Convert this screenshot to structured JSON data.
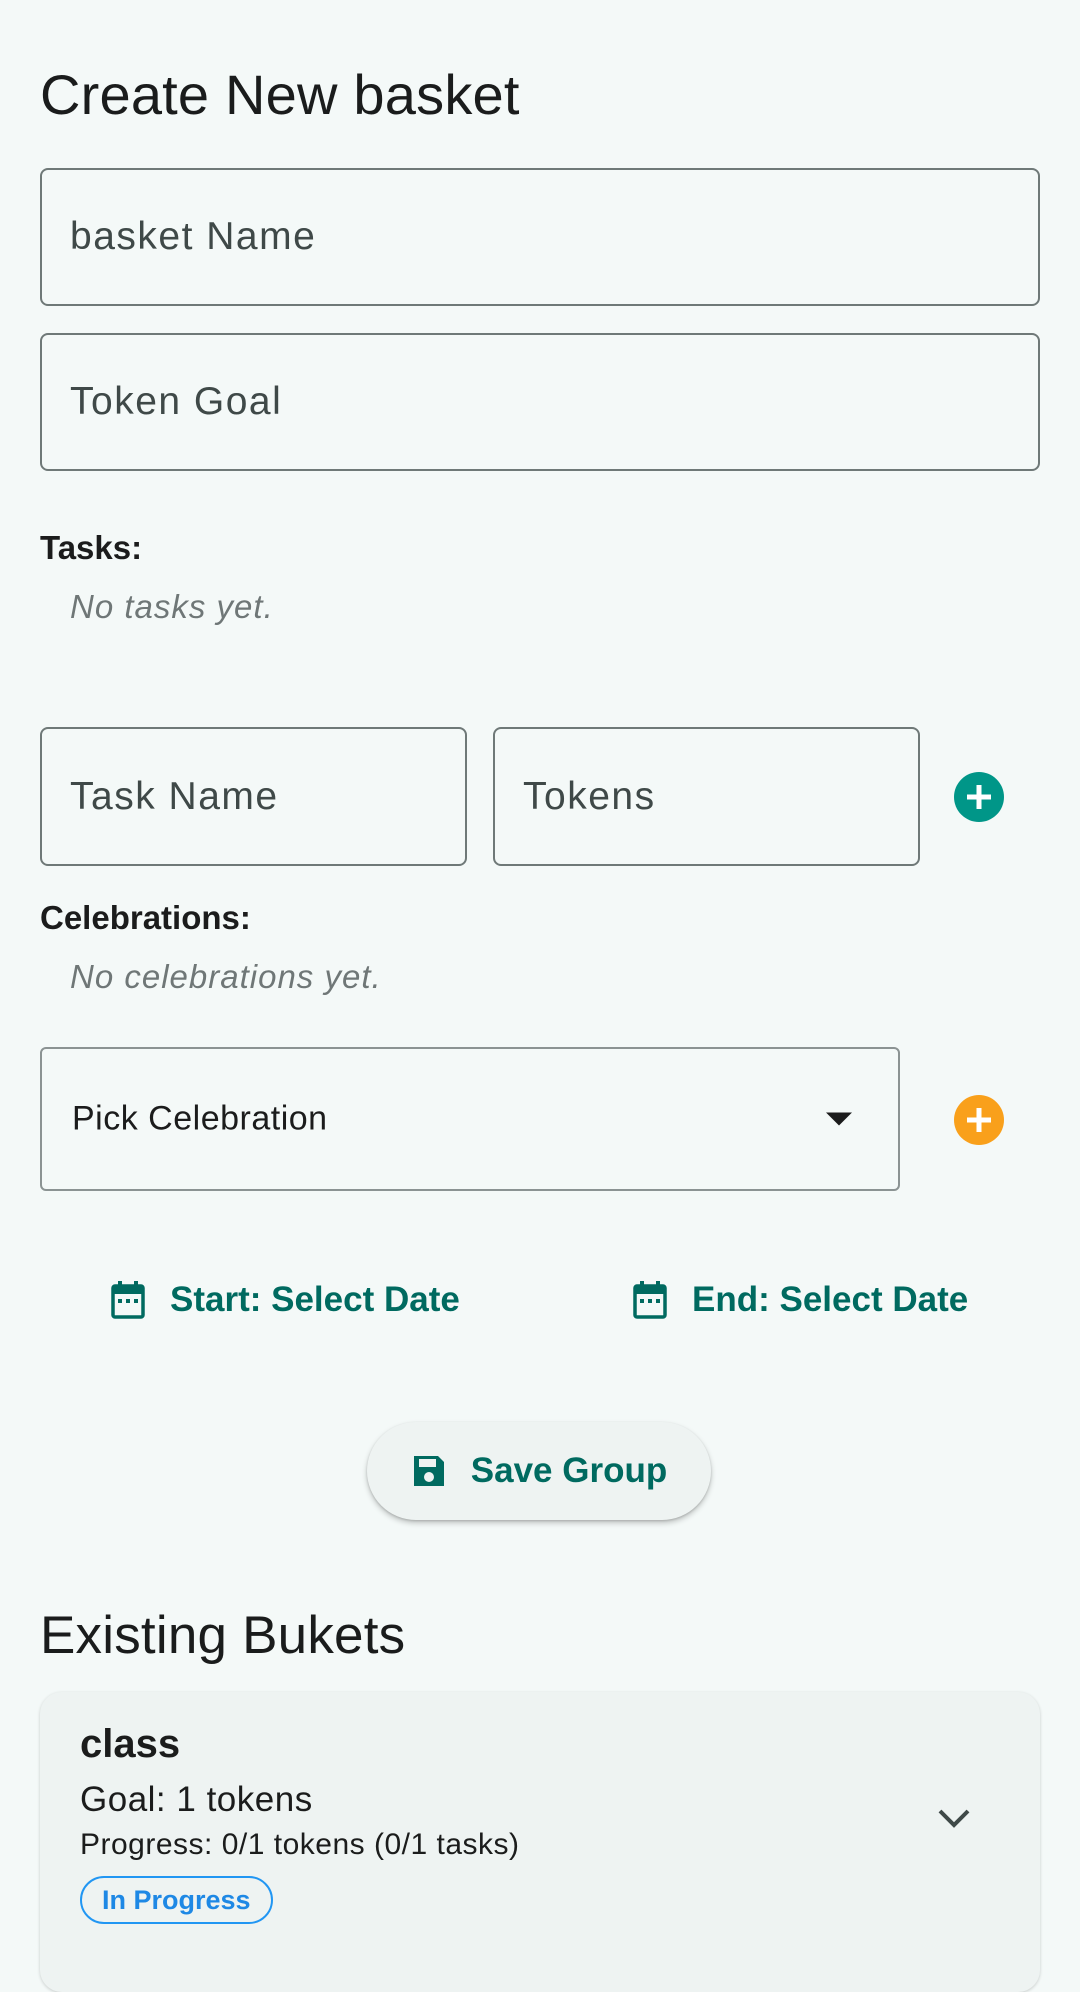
{
  "create": {
    "title": "Create New basket",
    "basket_name_placeholder": "basket Name",
    "token_goal_placeholder": "Token Goal"
  },
  "tasks": {
    "label": "Tasks:",
    "empty": "No tasks yet.",
    "task_name_placeholder": "Task Name",
    "tokens_placeholder": "Tokens",
    "add_icon": "add-circle-icon",
    "add_color": "#009688"
  },
  "celebrations": {
    "label": "Celebrations:",
    "empty": "No celebrations yet.",
    "picker_value": "Pick Celebration",
    "add_icon": "add-circle-icon",
    "add_color": "#f9a01b"
  },
  "dates": {
    "start_label": "Start: Select Date",
    "end_label": "End: Select Date",
    "icon": "calendar-icon"
  },
  "save": {
    "label": "Save Group",
    "icon": "save-icon"
  },
  "existing": {
    "title": "Existing Bukets",
    "items": [
      {
        "name": "class",
        "goal": "Goal: 1 tokens",
        "progress": "Progress: 0/1 tokens (0/1 tasks)",
        "status": "In Progress",
        "status_color": "#2196f3",
        "expand_icon": "chevron-down-icon"
      }
    ]
  },
  "colors": {
    "background": "#f4f9f8",
    "accent": "#006a60"
  }
}
